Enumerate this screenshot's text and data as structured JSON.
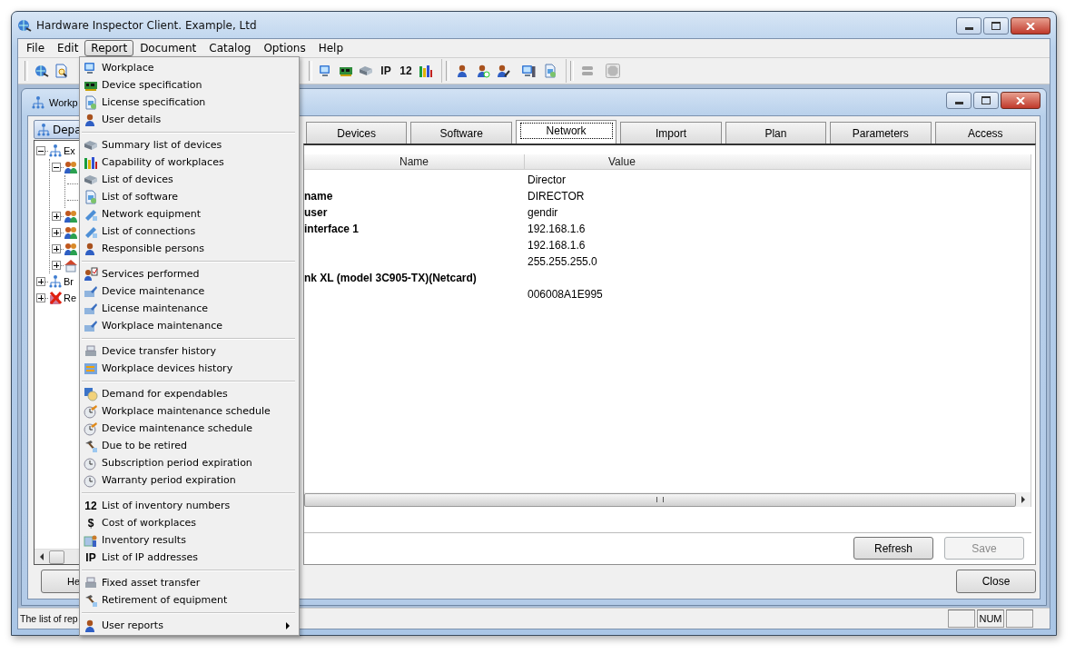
{
  "window": {
    "title": "Hardware Inspector Client. Example, Ltd"
  },
  "menubar": [
    {
      "label": "File",
      "selected": false
    },
    {
      "label": "Edit",
      "selected": false
    },
    {
      "label": "Report",
      "selected": true
    },
    {
      "label": "Document",
      "selected": false
    },
    {
      "label": "Catalog",
      "selected": false
    },
    {
      "label": "Options",
      "selected": false
    },
    {
      "label": "Help",
      "selected": false
    }
  ],
  "toolbar": {
    "glyphs": [
      "IP",
      "12"
    ]
  },
  "child_window": {
    "title": "Workp"
  },
  "department_button": {
    "label": "Depa"
  },
  "tree": [
    {
      "kind": "org",
      "label": "Ex",
      "expanded": true,
      "children": [
        {
          "kind": "people",
          "expanded": true,
          "children": [
            {
              "kind": "leaf"
            },
            {
              "kind": "leaf"
            }
          ]
        },
        {
          "kind": "people",
          "expanded": false
        },
        {
          "kind": "people",
          "expanded": false
        },
        {
          "kind": "people",
          "expanded": false
        },
        {
          "kind": "house",
          "expanded": false
        }
      ]
    },
    {
      "kind": "org",
      "label": "Br",
      "expanded": false
    },
    {
      "kind": "deleted",
      "label": "Re",
      "expanded": false
    }
  ],
  "tabs": [
    {
      "label": "Devices",
      "selected": false
    },
    {
      "label": "Software",
      "selected": false
    },
    {
      "label": "Network",
      "selected": true
    },
    {
      "label": "Import",
      "selected": false
    },
    {
      "label": "Plan",
      "selected": false
    },
    {
      "label": "Parameters",
      "selected": false
    },
    {
      "label": "Access",
      "selected": false
    }
  ],
  "grid": {
    "columns": [
      "Name",
      "Value"
    ],
    "rows": [
      {
        "value": "Director"
      },
      {
        "name": "name",
        "value": "DIRECTOR"
      },
      {
        "name": "user",
        "value": "gendir"
      },
      {
        "name": "interface 1",
        "value": "192.168.1.6"
      },
      {
        "value": "192.168.1.6"
      },
      {
        "value": "255.255.255.0"
      },
      {
        "name": "nk XL (model 3C905-TX)(Netcard)"
      },
      {
        "value": "006008A1E995"
      }
    ]
  },
  "panel_buttons": [
    {
      "label": "Refresh",
      "disabled": false
    },
    {
      "label": "Save",
      "disabled": true
    }
  ],
  "help_button": {
    "label": "He"
  },
  "close_button": {
    "label": "Close"
  },
  "status_bar": {
    "text": "The list of rep",
    "indicator": "NUM"
  },
  "menu": {
    "sections": [
      [
        {
          "label": "Workplace",
          "has_submenu": false
        },
        {
          "label": "Device specification",
          "has_submenu": false
        },
        {
          "label": "License specification",
          "has_submenu": false
        },
        {
          "label": "User details",
          "has_submenu": false
        }
      ],
      [
        {
          "label": "Summary list of devices",
          "has_submenu": false
        },
        {
          "label": "Capability of workplaces",
          "has_submenu": false
        },
        {
          "label": "List of devices",
          "has_submenu": false
        },
        {
          "label": "List of software",
          "has_submenu": false
        },
        {
          "label": "Network equipment",
          "has_submenu": false
        },
        {
          "label": "List of connections",
          "has_submenu": false
        },
        {
          "label": "Responsible persons",
          "has_submenu": false
        }
      ],
      [
        {
          "label": "Services performed",
          "has_submenu": false
        },
        {
          "label": "Device maintenance",
          "has_submenu": false
        },
        {
          "label": "License maintenance",
          "has_submenu": false
        },
        {
          "label": "Workplace maintenance",
          "has_submenu": false
        }
      ],
      [
        {
          "label": "Device transfer history",
          "has_submenu": false
        },
        {
          "label": "Workplace devices history",
          "has_submenu": false
        }
      ],
      [
        {
          "label": "Demand for expendables",
          "has_submenu": false
        },
        {
          "label": "Workplace maintenance schedule",
          "has_submenu": false
        },
        {
          "label": "Device maintenance schedule",
          "has_submenu": false
        },
        {
          "label": "Due to be retired",
          "has_submenu": false
        },
        {
          "label": "Subscription period expiration",
          "has_submenu": false
        },
        {
          "label": "Warranty period expiration",
          "has_submenu": false
        }
      ],
      [
        {
          "label": "List of inventory numbers",
          "glyph": "12",
          "has_submenu": false
        },
        {
          "label": "Cost of workplaces",
          "glyph": "$",
          "has_submenu": false
        },
        {
          "label": "Inventory results",
          "has_submenu": false
        },
        {
          "label": "List of IP addresses",
          "glyph": "IP",
          "has_submenu": false
        }
      ],
      [
        {
          "label": "Fixed asset transfer",
          "has_submenu": false
        },
        {
          "label": "Retirement of equipment",
          "has_submenu": false
        }
      ],
      [
        {
          "label": "User reports",
          "has_submenu": true
        }
      ]
    ]
  }
}
